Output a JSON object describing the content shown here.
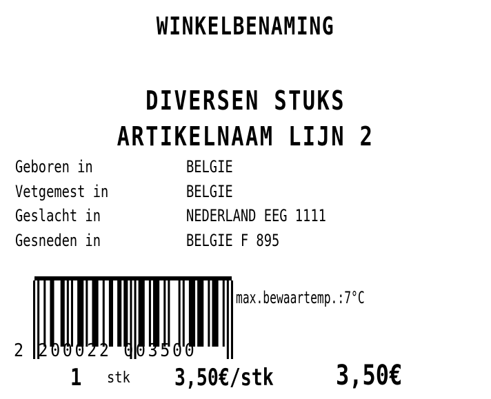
{
  "label": {
    "store_name": "WINKELBENAMING",
    "product_lines": [
      "DIVERSEN STUKS",
      "ARTIKELNAAM LIJN 2"
    ],
    "origin": [
      {
        "label": "Geboren in",
        "value": "BELGIE"
      },
      {
        "label": "Vetgemest in",
        "value": "BELGIE"
      },
      {
        "label": "Geslacht in",
        "value": "NEDERLAND EEG 1111"
      },
      {
        "label": "Gesneden in",
        "value": "BELGIE F 895"
      }
    ],
    "barcode": {
      "digits": "2 200022 003500",
      "bar_color": "#000000"
    },
    "storage_temp": "max.bewaartemp.:7°C",
    "quantity": "1",
    "unit": "stk",
    "unit_price": "3,50€/stk",
    "total_price": "3,50€"
  }
}
